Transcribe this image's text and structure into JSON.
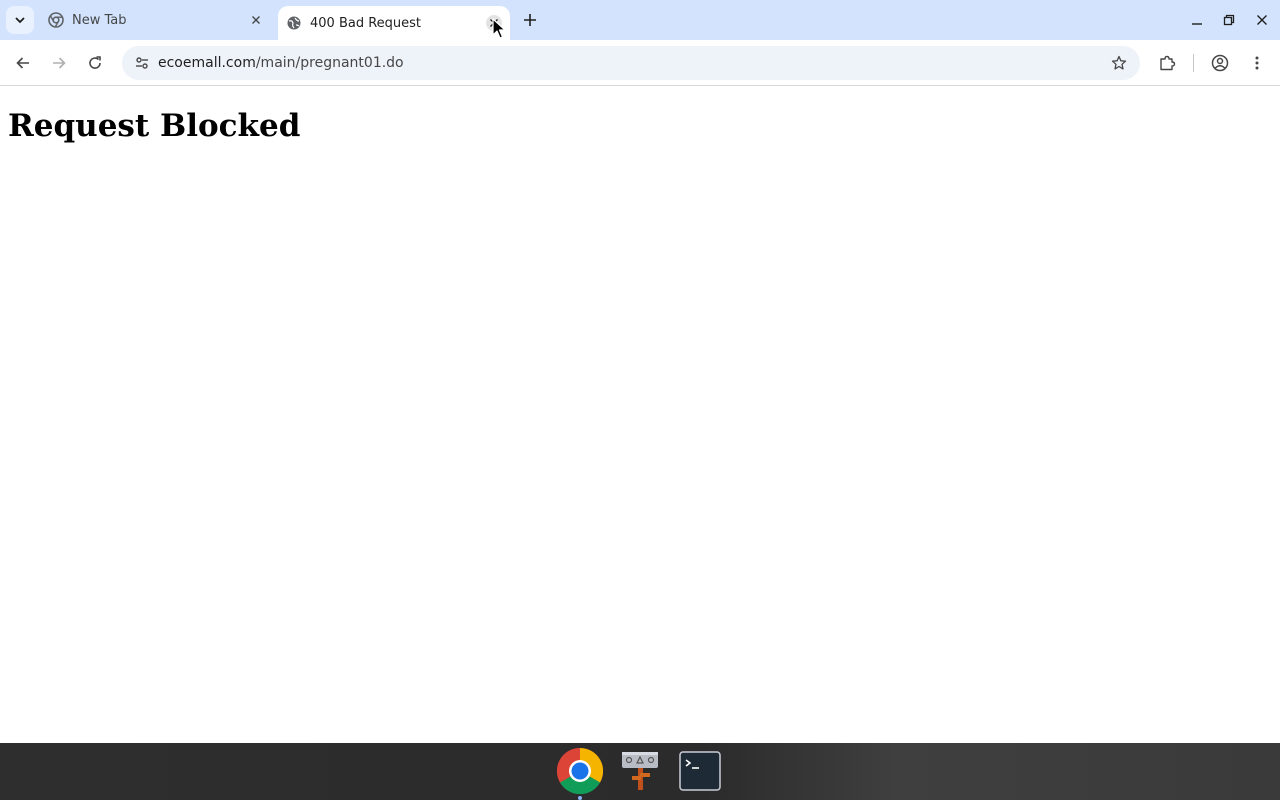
{
  "browser": {
    "tabs": [
      {
        "title": "New Tab",
        "active": false,
        "favicon": "chrome-icon"
      },
      {
        "title": "400 Bad Request",
        "active": true,
        "favicon": "globe-icon"
      }
    ],
    "new_tab_symbol": "+",
    "omnibox": {
      "host": "ecoemall.com",
      "path": "/main/pregnant01.do"
    }
  },
  "page": {
    "heading": "Request Blocked"
  },
  "shelf": {
    "apps": [
      "chrome-app",
      "shell-tool-app",
      "terminal-app"
    ]
  },
  "colors": {
    "tabstrip_bg": "#d3e3fd",
    "omnibox_bg": "#eef2f9",
    "shelf_bg": "#2e2e2e",
    "accent": "#8ab4f8"
  }
}
